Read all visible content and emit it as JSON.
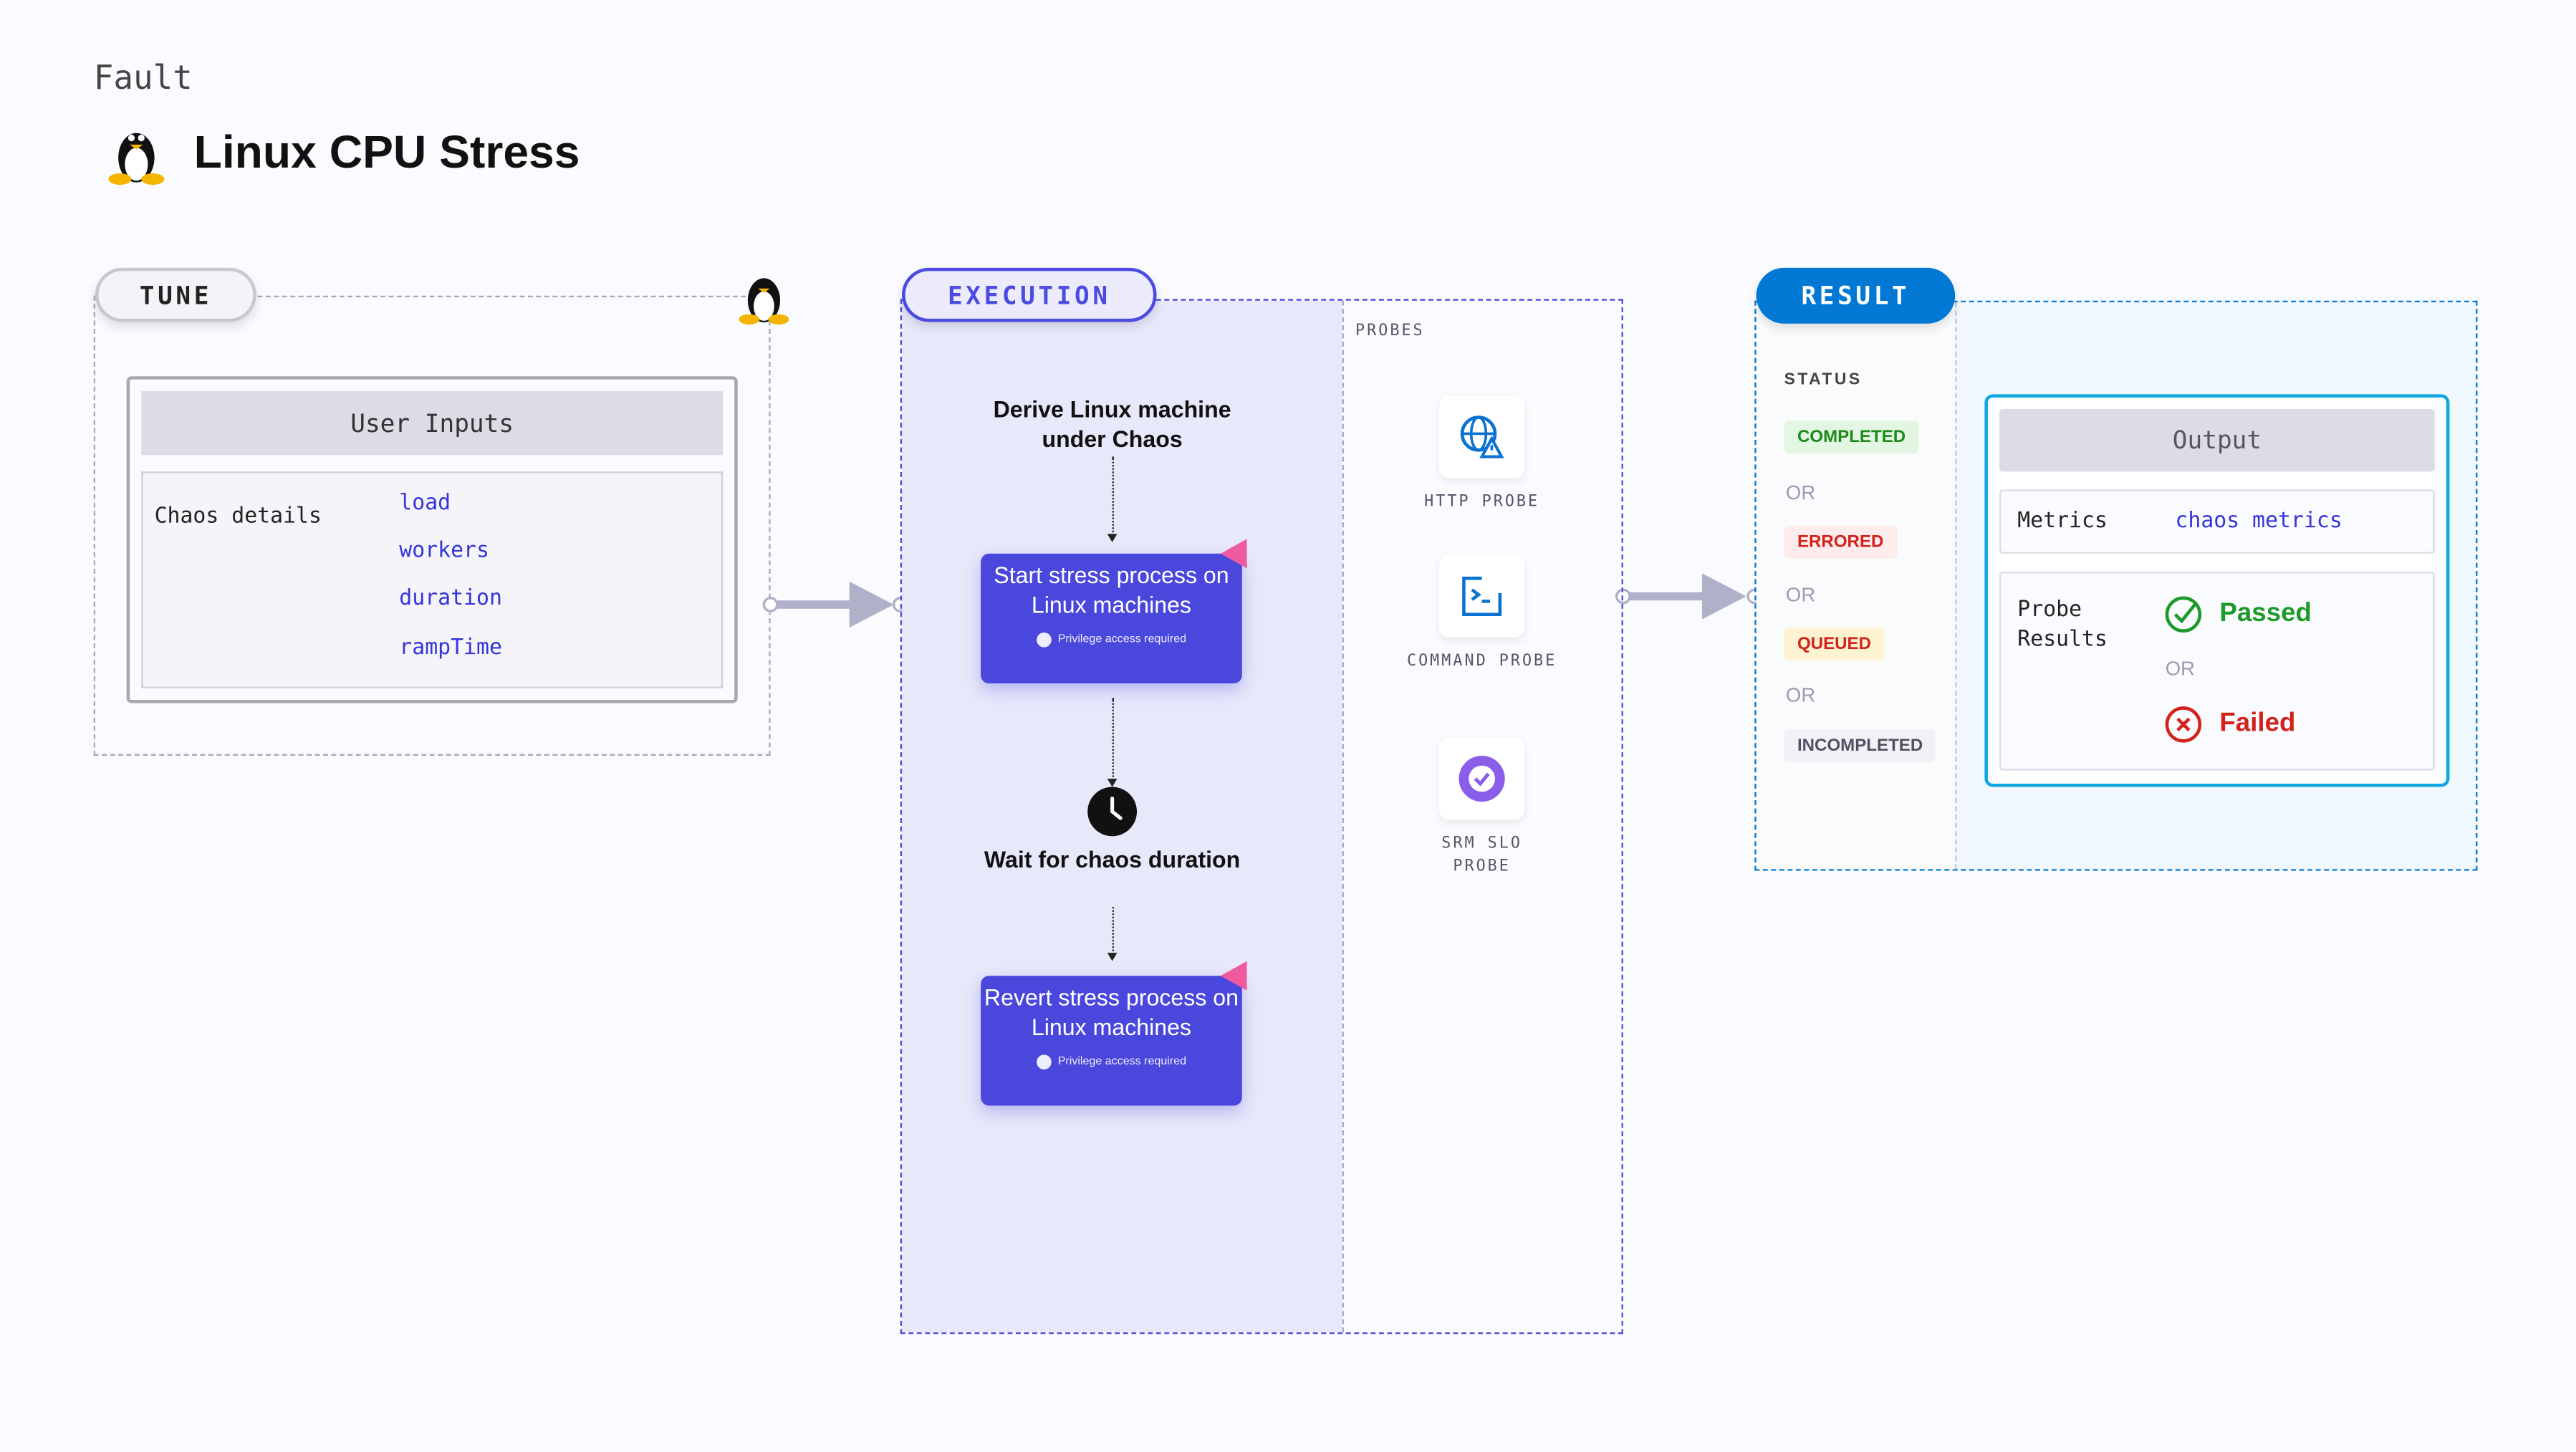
{
  "header": {
    "kicker": "Fault",
    "title": "Linux CPU Stress",
    "icon": "linux-penguin-icon"
  },
  "tune": {
    "label": "TUNE",
    "panel_title": "User Inputs",
    "field_label": "Chaos details",
    "values": [
      "load",
      "workers",
      "duration",
      "rampTime"
    ]
  },
  "execution": {
    "label": "EXECUTION",
    "probes_label": "PROBES",
    "step_intro": "Derive Linux machine under Chaos",
    "steps": [
      {
        "title": "Start stress process on Linux machines",
        "note": "Privilege access required"
      },
      {
        "title": "Revert stress process on Linux machines",
        "note": "Privilege access required"
      }
    ],
    "wait": "Wait for chaos duration",
    "probes": [
      {
        "label": "HTTP PROBE",
        "icon": "globe-warning-icon"
      },
      {
        "label": "COMMAND PROBE",
        "icon": "terminal-icon"
      },
      {
        "label": "SRM SLO PROBE",
        "icon": "slo-check-icon"
      }
    ]
  },
  "result": {
    "label": "RESULT",
    "status_label": "STATUS",
    "statuses": [
      {
        "label": "COMPLETED",
        "color": "#1e8a1e",
        "bg": "#e3f6e1"
      },
      {
        "label": "ERRORED",
        "color": "#d3221b",
        "bg": "#fdeceb"
      },
      {
        "label": "QUEUED",
        "color": "#d3221b",
        "bg": "#fdf3d0"
      },
      {
        "label": "INCOMPLETED",
        "color": "#4f5162",
        "bg": "#f1f1f6"
      }
    ],
    "or": "OR",
    "output": {
      "title": "Output",
      "metrics_label": "Metrics",
      "metrics_value": "chaos metrics",
      "probe_label_1": "Probe",
      "probe_label_2": "Results",
      "passed": "Passed",
      "or": "OR",
      "failed": "Failed"
    }
  },
  "colors": {
    "execution": "#4b4bdf",
    "result": "#0078d4",
    "output_border": "#11a8e0",
    "step_bg": "#4a47dc"
  }
}
